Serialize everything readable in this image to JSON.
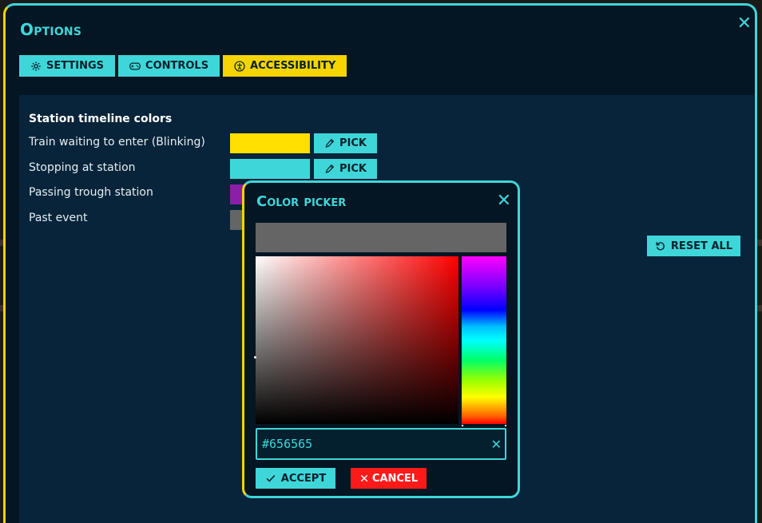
{
  "options": {
    "title": "Options",
    "close_label": "✕",
    "tabs": [
      {
        "label": "Settings",
        "icon": "gear-icon"
      },
      {
        "label": "Controls",
        "icon": "gamepad-icon"
      },
      {
        "label": "Accessibility",
        "icon": "accessibility-icon",
        "active": true
      }
    ]
  },
  "accessibility": {
    "section_title": "Station timeline colors",
    "rows": [
      {
        "label": "Train waiting to enter (Blinking)",
        "color": "#ffe000",
        "pick_label": "PICK"
      },
      {
        "label": "Stopping at station",
        "color": "#3fd6d9",
        "pick_label": "PICK"
      },
      {
        "label": "Passing trough station",
        "color": "#8a1fa8"
      },
      {
        "label": "Past event",
        "color": "#656565"
      }
    ],
    "reset_label": "RESET ALL"
  },
  "color_picker": {
    "title": "Color picker",
    "close_label": "✕",
    "current_color": "#656565",
    "hex_value": "#656565",
    "clear_label": "✕",
    "accept_label": "ACCEPT",
    "cancel_label": "CANCEL"
  },
  "colors": {
    "accent": "#3fd6d9",
    "active_tab": "#f5d400",
    "cancel": "#ff1a1a",
    "background": "#041623",
    "panel": "#07243a"
  }
}
